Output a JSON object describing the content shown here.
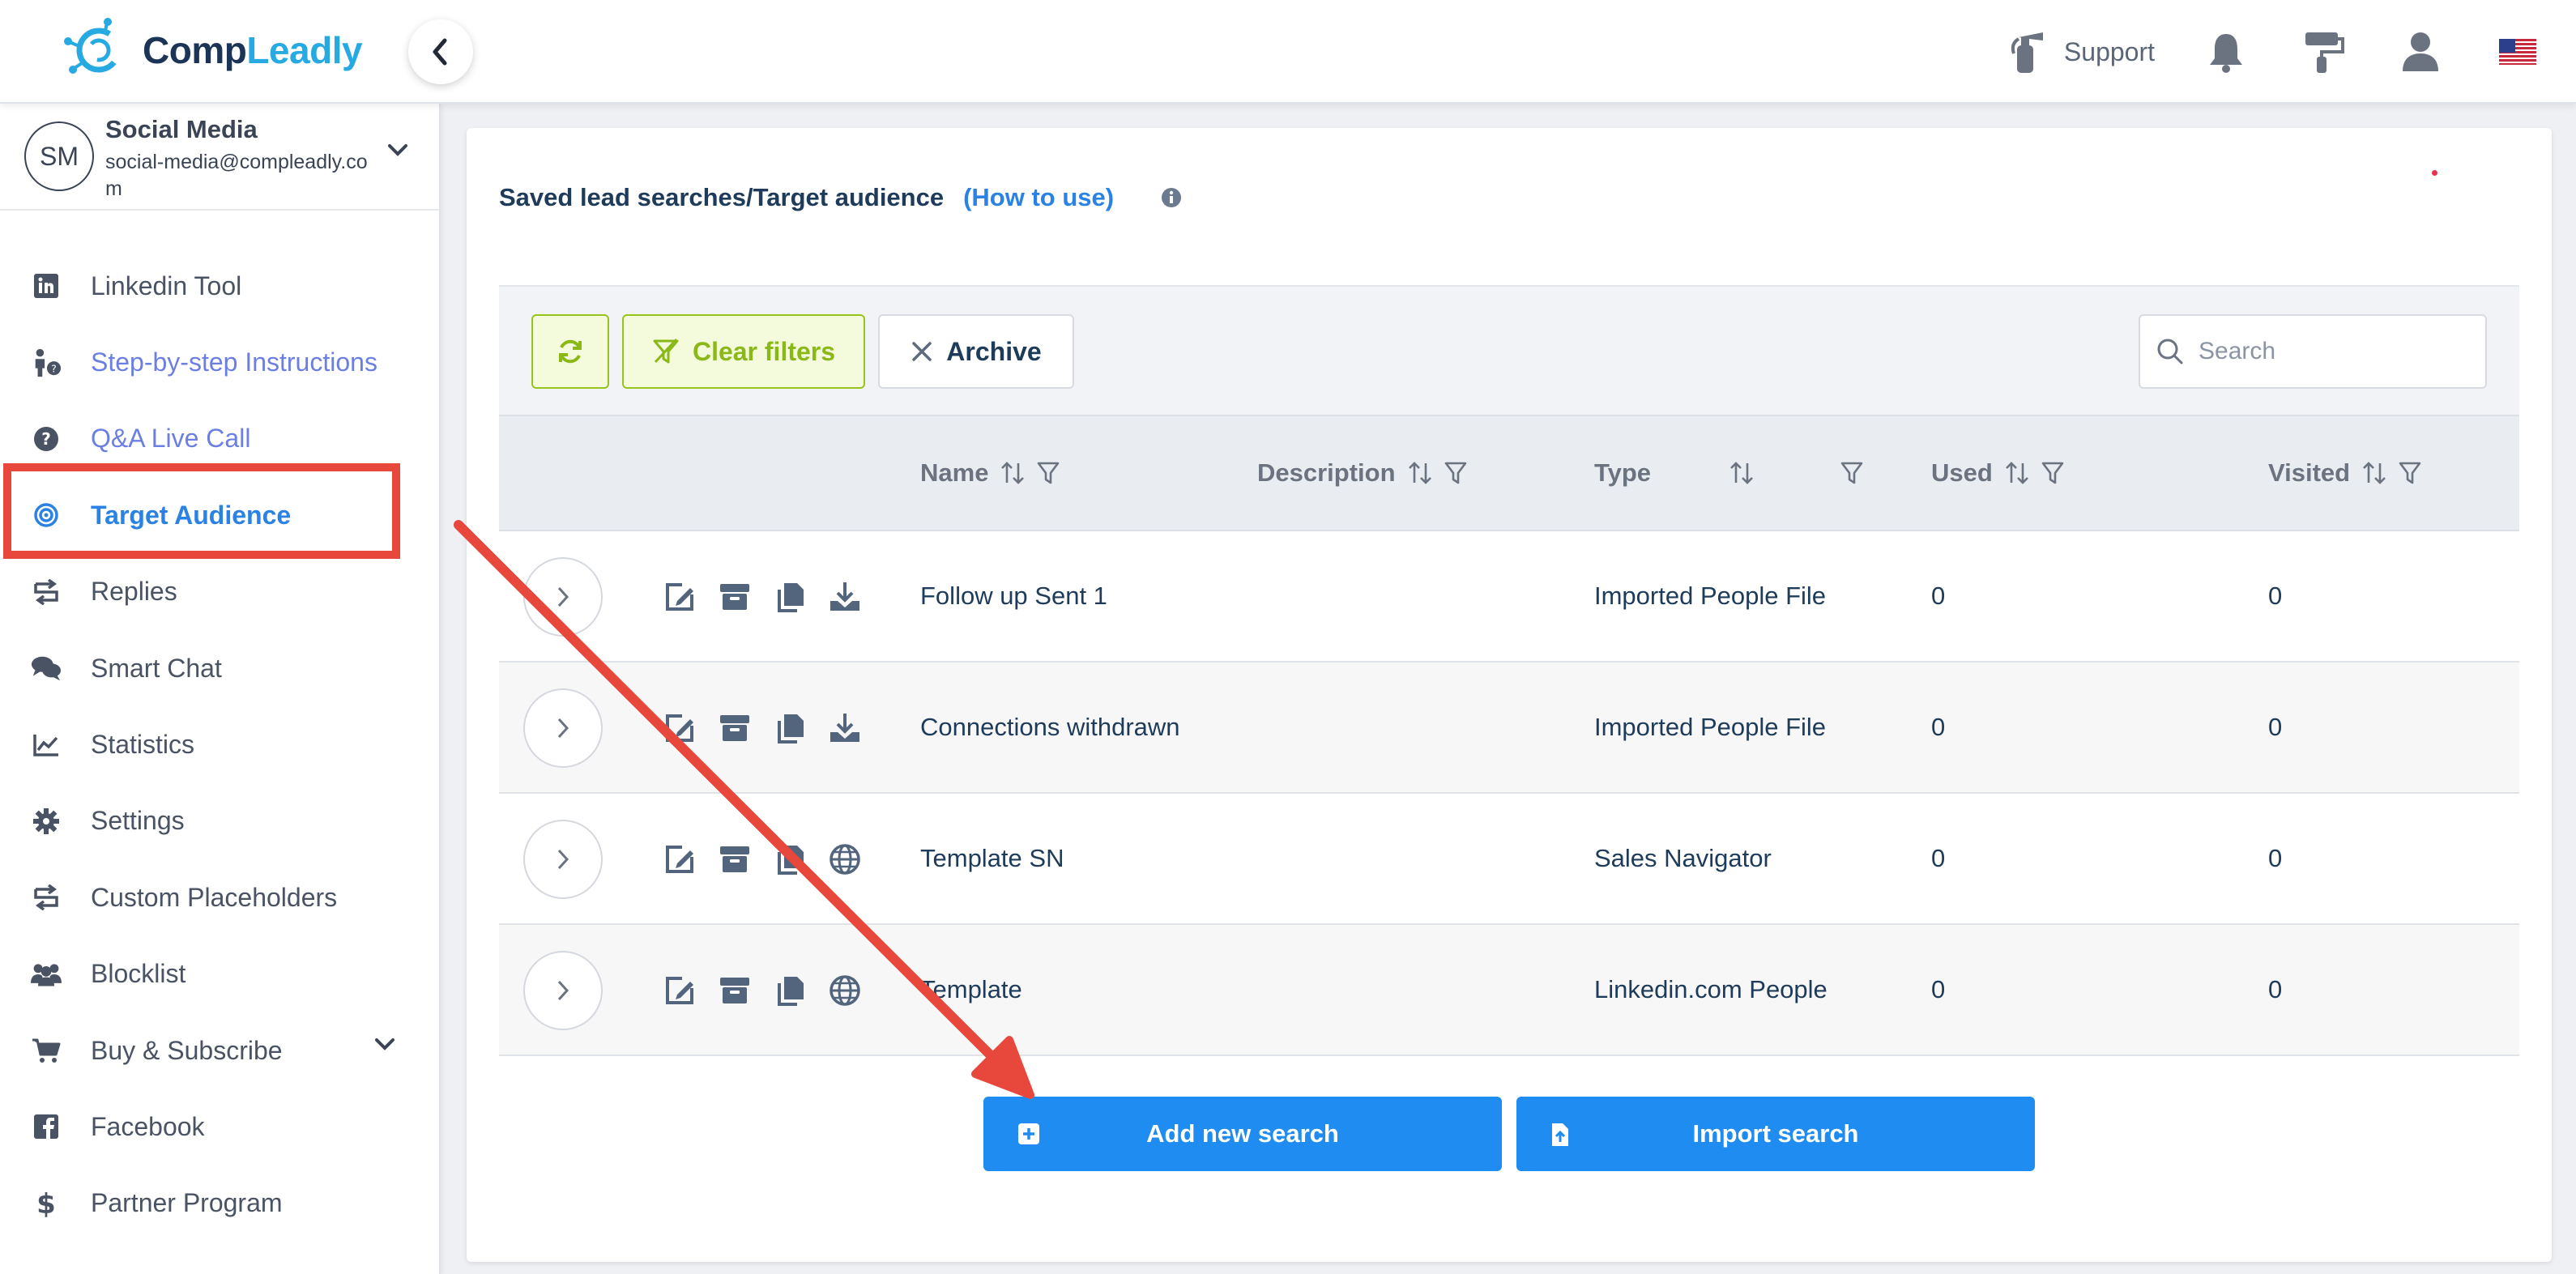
{
  "header": {
    "logo_part1": "Comp",
    "logo_part2": "Leadly",
    "support_label": "Support"
  },
  "account": {
    "initials": "SM",
    "name": "Social Media",
    "email": "social-media@compleadly.com"
  },
  "sidebar": {
    "items": [
      {
        "label": "Linkedin Tool",
        "icon": "linkedin-icon"
      },
      {
        "label": "Step-by-step Instructions",
        "icon": "instructions-icon"
      },
      {
        "label": "Q&A Live Call",
        "icon": "question-icon"
      },
      {
        "label": "Target Audience",
        "icon": "target-icon"
      },
      {
        "label": "Replies",
        "icon": "replies-icon"
      },
      {
        "label": "Smart Chat",
        "icon": "chat-icon"
      },
      {
        "label": "Statistics",
        "icon": "chart-icon"
      },
      {
        "label": "Settings",
        "icon": "gear-icon"
      },
      {
        "label": "Custom Placeholders",
        "icon": "placeholder-icon"
      },
      {
        "label": "Blocklist",
        "icon": "users-block-icon"
      },
      {
        "label": "Buy & Subscribe",
        "icon": "cart-icon"
      },
      {
        "label": "Facebook",
        "icon": "facebook-icon"
      },
      {
        "label": "Partner Program",
        "icon": "dollar-icon"
      }
    ]
  },
  "main": {
    "title": "Saved lead searches/Target audience",
    "how_to": "(How to use)",
    "toolbar": {
      "clear_filters": "Clear filters",
      "archive": "Archive",
      "search_placeholder": "Search"
    },
    "columns": [
      "Name",
      "Description",
      "Type",
      "Used",
      "Visited"
    ],
    "rows": [
      {
        "name": "Follow up Sent 1",
        "description": "",
        "type": "Imported People File",
        "used": "0",
        "visited": "0"
      },
      {
        "name": "Connections withdrawn",
        "description": "",
        "type": "Imported People File",
        "used": "0",
        "visited": "0"
      },
      {
        "name": "Template SN",
        "description": "",
        "type": "Sales Navigator",
        "used": "0",
        "visited": "0"
      },
      {
        "name": "Template",
        "description": "",
        "type": "Linkedin.com People",
        "used": "0",
        "visited": "0"
      }
    ],
    "add_new_search": "Add new search",
    "import_search": "Import search"
  },
  "colors": {
    "primary": "#1e8cf0",
    "highlight": "#e8473b",
    "filter_green": "#99c41c",
    "text_dark": "#1f3b5a"
  }
}
